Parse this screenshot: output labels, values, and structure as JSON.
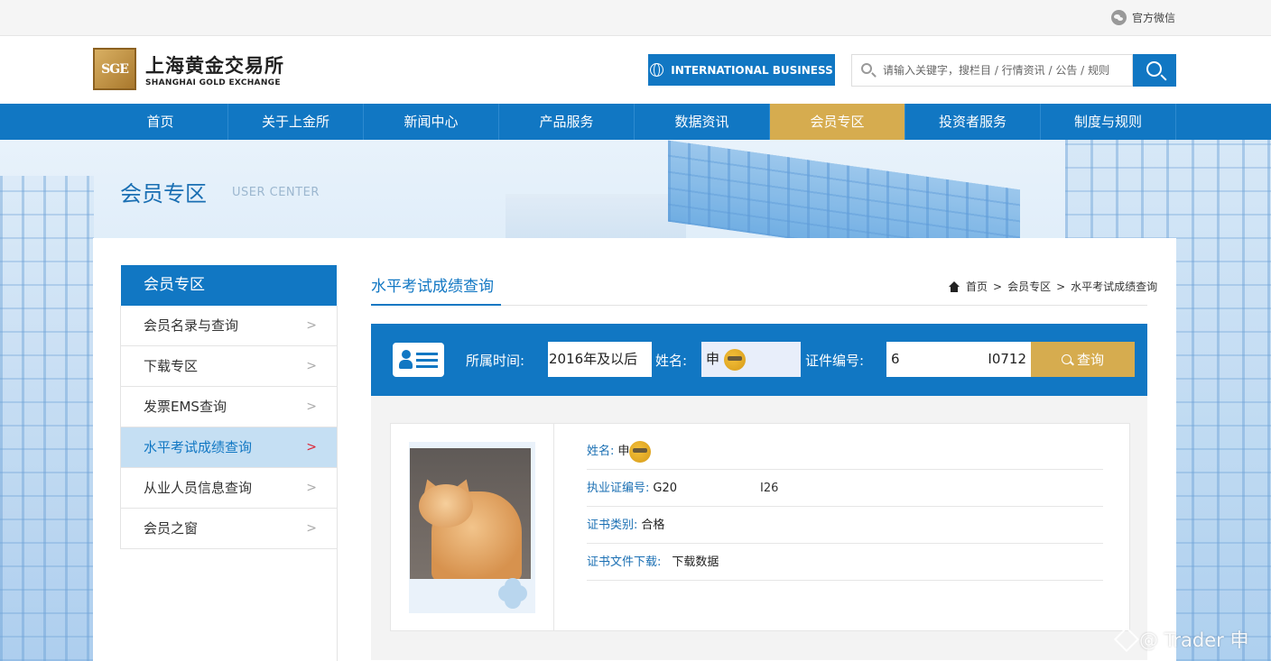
{
  "topbar": {
    "wechat_label": "官方微信"
  },
  "header": {
    "logo_mark": "SGE",
    "logo_cn": "上海黄金交易所",
    "logo_en": "SHANGHAI GOLD EXCHANGE",
    "intl_button": "INTERNATIONAL BUSINESS",
    "search_placeholder": "请输入关键字，搜栏目 / 行情资讯 / 公告 / 规则"
  },
  "nav": {
    "items": [
      {
        "label": "首页"
      },
      {
        "label": "关于上金所"
      },
      {
        "label": "新闻中心"
      },
      {
        "label": "产品服务"
      },
      {
        "label": "数据资讯"
      },
      {
        "label": "会员专区"
      },
      {
        "label": "投资者服务"
      },
      {
        "label": "制度与规则"
      }
    ],
    "active_index": 5
  },
  "banner": {
    "title": "会员专区",
    "subtitle": "USER CENTER"
  },
  "sidebar": {
    "title": "会员专区",
    "items": [
      {
        "label": "会员名录与查询"
      },
      {
        "label": "下载专区"
      },
      {
        "label": "发票EMS查询"
      },
      {
        "label": "水平考试成绩查询"
      },
      {
        "label": "从业人员信息查询"
      },
      {
        "label": "会员之窗"
      }
    ],
    "active_index": 3
  },
  "main": {
    "title": "水平考试成绩查询",
    "breadcrumb": [
      "首页",
      "会员专区",
      "水平考试成绩查询"
    ],
    "breadcrumb_sep": ">"
  },
  "query": {
    "period_label": "所属时间:",
    "period_value": "2016年及以后",
    "name_label": "姓名:",
    "name_value": "申",
    "cert_label": "证件编号:",
    "cert_prefix": "6",
    "cert_suffix": "I0712",
    "submit_label": "查询"
  },
  "result": {
    "name_key": "姓名:",
    "name_value": "申",
    "license_key": "执业证编号:",
    "license_prefix": "G20",
    "license_suffix": "I26",
    "cert_type_key": "证书类别:",
    "cert_type_value": "合格",
    "download_key": "证书文件下载:",
    "download_value": "下载数据"
  },
  "watermark": {
    "text": "@ Trader 申"
  },
  "colors": {
    "brand_blue": "#1177c3",
    "gold": "#d6ac4f",
    "active_side": "#c5dff3"
  }
}
